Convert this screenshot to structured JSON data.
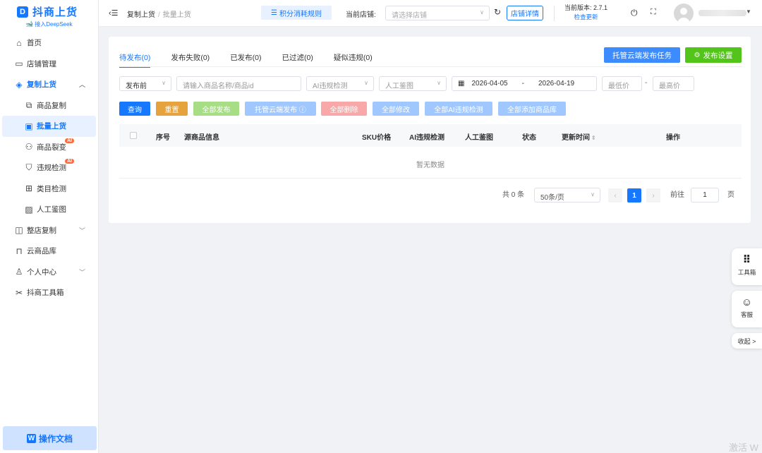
{
  "app": {
    "brand": "抖商上货",
    "logo_letter": "D",
    "tagline": "接入DeepSeek",
    "doc_button": "操作文档"
  },
  "sidebar": {
    "items": [
      {
        "label": "首页",
        "icon": "home-icon"
      },
      {
        "label": "店铺管理",
        "icon": "store-icon"
      },
      {
        "label": "复制上货",
        "icon": "box-icon",
        "expanded": true
      },
      {
        "label": "商品复制",
        "icon": "copy-icon"
      },
      {
        "label": "批量上货",
        "icon": "batch-icon",
        "selected": true
      },
      {
        "label": "商品裂变",
        "icon": "fission-icon",
        "badge": "AI"
      },
      {
        "label": "违规检测",
        "icon": "shield-icon",
        "badge": "AI"
      },
      {
        "label": "类目检测",
        "icon": "grid-icon"
      },
      {
        "label": "人工鉴图",
        "icon": "image-icon"
      },
      {
        "label": "整店复制",
        "icon": "shop-copy-icon"
      },
      {
        "label": "云商品库",
        "icon": "cloud-store-icon"
      },
      {
        "label": "个人中心",
        "icon": "user-icon"
      },
      {
        "label": "抖商工具箱",
        "icon": "tools-icon"
      }
    ]
  },
  "header": {
    "breadcrumb": [
      "复制上货",
      "批量上货"
    ],
    "points_rule": "积分消耗规则",
    "store_label": "当前店铺:",
    "store_placeholder": "请选择店铺",
    "store_detail": "店铺详情",
    "version_label": "当前版本: 2.7.1",
    "check_update": "检查更新"
  },
  "tabs": [
    "待发布(0)",
    "发布失败(0)",
    "已发布(0)",
    "已过滤(0)",
    "疑似违规(0)"
  ],
  "actions": {
    "cloud_task": "托管云端发布任务",
    "publish_settings": "发布设置"
  },
  "filters": {
    "status_value": "发布前",
    "search_placeholder": "请输入商品名称/商品id",
    "ai_check_placeholder": "AI违规检测",
    "manual_check_placeholder": "人工鉴图",
    "date_start": "2026-04-05",
    "date_sep": "-",
    "date_end": "2026-04-19",
    "min_price": "最低价",
    "price_sep": "-",
    "max_price": "最高价"
  },
  "buttons": [
    {
      "label": "查询",
      "color": "#1677ff"
    },
    {
      "label": "重置",
      "color": "#e6a23c"
    },
    {
      "label": "全部发布",
      "color": "#a6dd85"
    },
    {
      "label": "托管云端发布 ⓘ",
      "color": "#a0c8ff"
    },
    {
      "label": "全部删除",
      "color": "#f8a8a8"
    },
    {
      "label": "全部修改",
      "color": "#a0c8ff"
    },
    {
      "label": "全部AI违规检测",
      "color": "#a0c8ff"
    },
    {
      "label": "全部添加商品库",
      "color": "#a0c8ff"
    }
  ],
  "table": {
    "columns": [
      "序号",
      "源商品信息",
      "SKU价格",
      "AI违规检测",
      "人工鉴图",
      "状态",
      "更新时间",
      "操作"
    ],
    "empty_text": "暂无数据"
  },
  "pagination": {
    "total": "共 0 条",
    "page_size": "50条/页",
    "current_page": "1",
    "goto_label": "前往",
    "goto_value": "1",
    "page_suffix": "页"
  },
  "float_tools": {
    "toolbox": "工具箱",
    "service": "客服",
    "collapse": "收起 >"
  },
  "watermark": "激活 W"
}
